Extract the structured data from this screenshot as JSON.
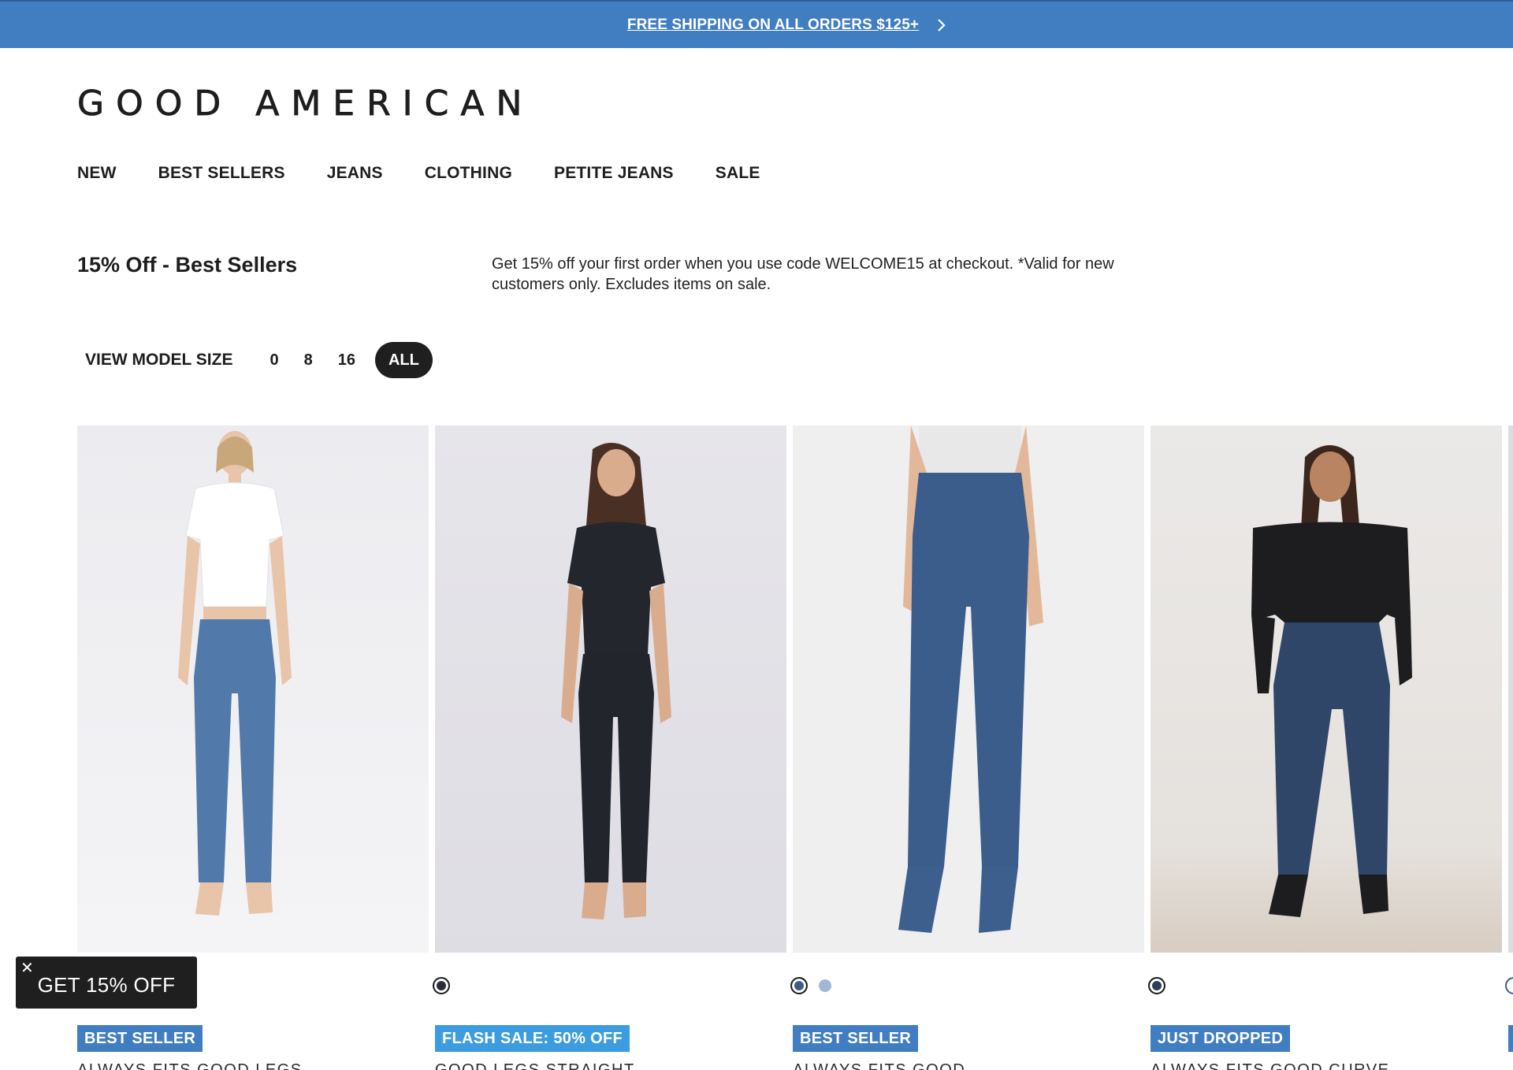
{
  "promo_bar": {
    "text": "FREE SHIPPING ON ALL ORDERS $125+",
    "chevron_icon": "chevron-right-icon",
    "background": "#417dc1"
  },
  "logo": {
    "text": "GOOD AMERICAN"
  },
  "nav": {
    "items": [
      {
        "label": "NEW"
      },
      {
        "label": "BEST SELLERS"
      },
      {
        "label": "JEANS"
      },
      {
        "label": "CLOTHING"
      },
      {
        "label": "PETITE JEANS"
      },
      {
        "label": "SALE"
      }
    ]
  },
  "collection": {
    "title": "15% Off - Best Sellers",
    "description": "Get 15% off your first order when you use code WELCOME15 at checkout. *Valid for new customers only. Excludes items on sale."
  },
  "model_size": {
    "label": "VIEW MODEL SIZE",
    "options": [
      "0",
      "8",
      "16",
      "ALL"
    ],
    "selected": "ALL"
  },
  "products": [
    {
      "badge": "BEST SELLER",
      "badge_color": "#417dc1",
      "name": "ALWAYS FITS GOOD LEGS",
      "swatches": []
    },
    {
      "badge": "FLASH SALE: 50% OFF",
      "badge_color": "#3d9ce0",
      "name": "GOOD LEGS STRAIGHT",
      "swatches": [
        "#2b2e36"
      ]
    },
    {
      "badge": "BEST SELLER",
      "badge_color": "#417dc1",
      "name": "ALWAYS FITS GOOD",
      "swatches": [
        "#3e5d86",
        "#9fb8d4"
      ]
    },
    {
      "badge": "JUST DROPPED",
      "badge_color": "#417dc1",
      "name": "ALWAYS FITS GOOD CURVE",
      "swatches": [
        "#2d3e5a"
      ]
    }
  ],
  "popup": {
    "text": "GET 15% OFF",
    "close_icon": "close-icon"
  }
}
